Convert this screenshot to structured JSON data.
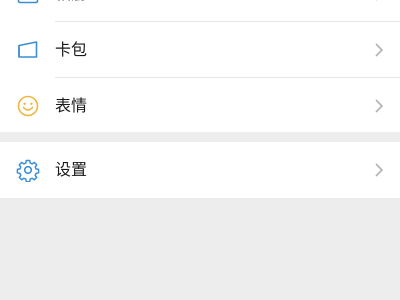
{
  "menu": {
    "items": [
      {
        "label": "相册",
        "icon": "photo-album-icon"
      },
      {
        "label": "卡包",
        "icon": "card-wallet-icon"
      },
      {
        "label": "表情",
        "icon": "smiley-face-icon"
      }
    ]
  },
  "settings_section": {
    "items": [
      {
        "label": "设置",
        "icon": "gear-icon"
      }
    ]
  },
  "colors": {
    "background": "#ededed",
    "card": "#ffffff",
    "icon_blue": "#3d8fd4",
    "icon_yellow": "#f1b641",
    "chevron": "#b2b2b2"
  }
}
